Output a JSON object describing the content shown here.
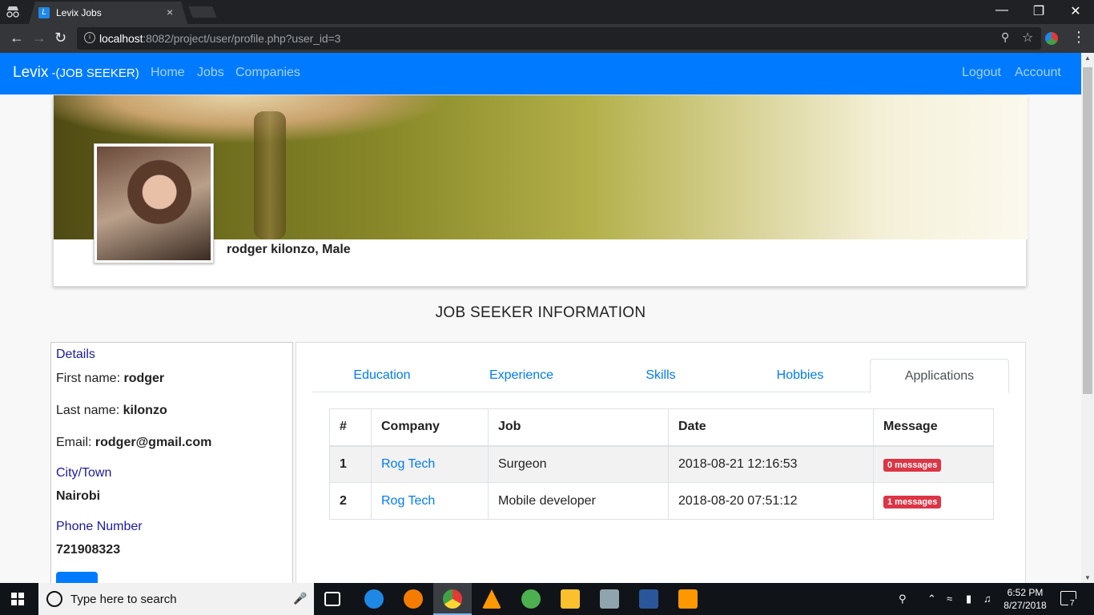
{
  "browser": {
    "tab_title": "Levix Jobs",
    "tab_close": "×",
    "url_host": "localhost",
    "url_rest": ":8082/project/user/profile.php?user_id=3",
    "window_controls": [
      "—",
      "❐",
      "✕"
    ]
  },
  "nav": {
    "brand": "Levix",
    "brand_sub": " -(JOB SEEKER)",
    "links": [
      "Home",
      "Jobs",
      "Companies"
    ],
    "right_links": [
      "Logout",
      "Account"
    ]
  },
  "profile": {
    "name_line": "rodger kilonzo, Male"
  },
  "section_title": "JOB SEEKER INFORMATION",
  "details": {
    "heading": "Details",
    "first_name_label": "First name: ",
    "first_name": "rodger",
    "last_name_label": "Last name: ",
    "last_name": "kilonzo",
    "email_label": "Email: ",
    "email": "rodger@gmail.com",
    "city_heading": "City/Town",
    "city": "Nairobi",
    "phone_heading": "Phone Number",
    "phone": "721908323"
  },
  "tabs": [
    "Education",
    "Experience",
    "Skills",
    "Hobbies",
    "Applications"
  ],
  "active_tab": "Applications",
  "applications": {
    "headers": [
      "#",
      "Company",
      "Job",
      "Date",
      "Message"
    ],
    "rows": [
      {
        "num": "1",
        "company": "Rog Tech",
        "job": "Surgeon",
        "date": "2018-08-21 12:16:53",
        "message": "0 messages"
      },
      {
        "num": "2",
        "company": "Rog Tech",
        "job": "Mobile developer",
        "date": "2018-08-20 07:51:12",
        "message": "1 messages"
      }
    ]
  },
  "taskbar": {
    "search_placeholder": "Type here to search",
    "time": "6:52 PM",
    "date": "8/27/2018",
    "notification_count": "7"
  },
  "colors": {
    "primary": "#007bff",
    "danger": "#dc3545",
    "details_heading": "#1a1aa6"
  }
}
